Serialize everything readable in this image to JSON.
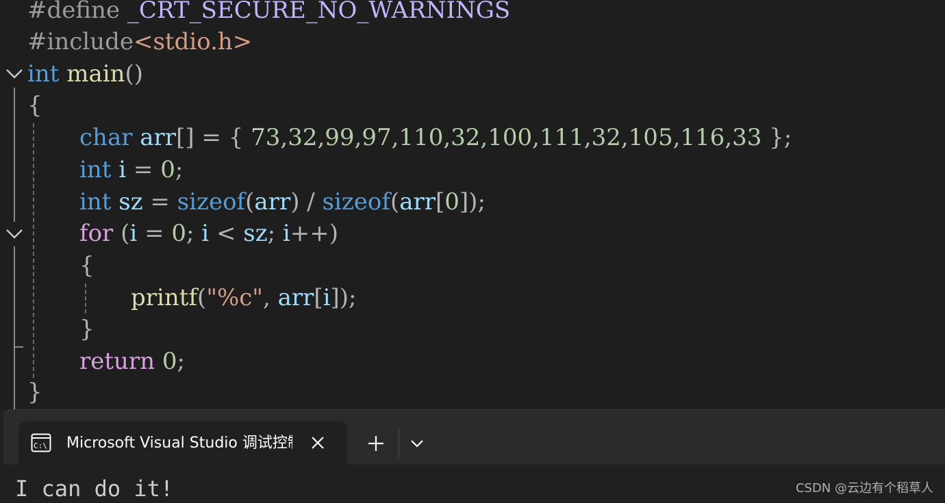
{
  "editor": {
    "line1": {
      "directive": "#define",
      "name": "_CRT_SECURE_NO_WARNINGS"
    },
    "line2": {
      "directive": "#include",
      "header": "<stdio.h>"
    },
    "line3": {
      "type": "int",
      "name": "main",
      "paren": "()"
    },
    "line4": {
      "brace": "{"
    },
    "line5": {
      "type": "char",
      "var": "arr",
      "brackets": "[]",
      "assign": " = { ",
      "values": "73,32,99,97,110,32,100,111,32,105,116,33",
      "close": " };"
    },
    "line6": {
      "type": "int",
      "var": "i",
      "assign": " = ",
      "num": "0",
      "semi": ";"
    },
    "line7": {
      "type": "int",
      "var": "sz",
      "assign": " = ",
      "fn1": "sizeof",
      "p1": "(",
      "arg1": "arr",
      "div": ") / ",
      "fn2": "sizeof",
      "p2": "(",
      "arg2": "arr",
      "b1": "[",
      "idx": "0",
      "tail": "]);"
    },
    "line8": {
      "kw": "for",
      "open": " (",
      "i1": "i",
      "eq": " = ",
      "zero": "0",
      "s1": "; ",
      "i2": "i",
      "lt": " < ",
      "sz": "sz",
      "s2": "; ",
      "i3": "i",
      "inc": "++)"
    },
    "line9": {
      "brace": "{"
    },
    "line10": {
      "fn": "printf",
      "open": "(",
      "fmt": "\"%c\"",
      "comma": ", ",
      "arr": "arr",
      "b1": "[",
      "i": "i",
      "tail": "]);"
    },
    "line11": {
      "brace": "}"
    },
    "line12": {
      "kw": "return",
      "space": " ",
      "num": "0",
      "semi": ";"
    },
    "line13": {
      "brace": "}"
    }
  },
  "console": {
    "tab_title": "Microsoft Visual Studio 调试控制台",
    "tab_icon": "terminal-icon",
    "close_icon": "close-icon",
    "new_tab_icon": "plus-icon",
    "menu_icon": "chevron-down-icon",
    "output": "I can do it!"
  },
  "watermark": "CSDN @云边有个稻草人"
}
